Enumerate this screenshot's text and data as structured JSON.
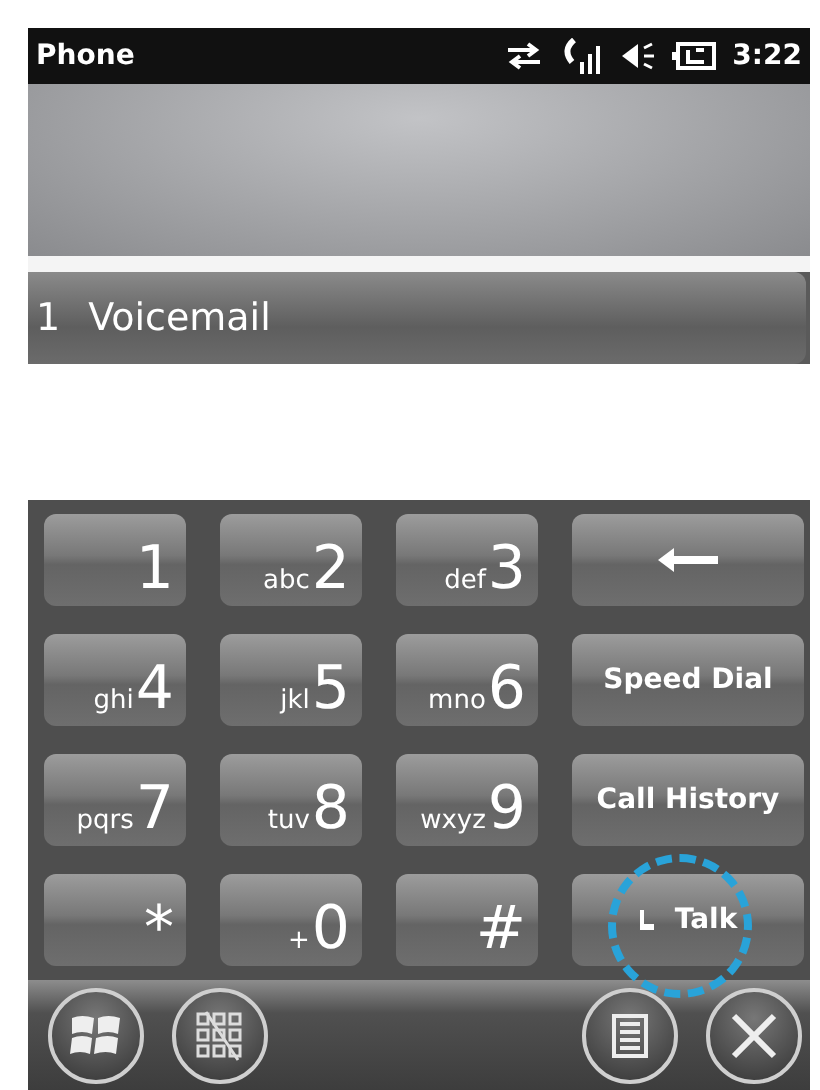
{
  "status_bar": {
    "title": "Phone",
    "time": "3:22"
  },
  "speed_dial_entry": {
    "number": "1",
    "name": "Voicemail"
  },
  "keypad": [
    {
      "kind": "digit",
      "digit": "1"
    },
    {
      "kind": "digit",
      "digit": "2",
      "letters": "abc"
    },
    {
      "kind": "digit",
      "digit": "3",
      "letters": "def"
    },
    {
      "kind": "backspace"
    },
    {
      "kind": "digit",
      "digit": "4",
      "letters": "ghi"
    },
    {
      "kind": "digit",
      "digit": "5",
      "letters": "jkl"
    },
    {
      "kind": "digit",
      "digit": "6",
      "letters": "mno"
    },
    {
      "kind": "action",
      "label": "Speed Dial"
    },
    {
      "kind": "digit",
      "digit": "7",
      "letters": "pqrs"
    },
    {
      "kind": "digit",
      "digit": "8",
      "letters": "tuv"
    },
    {
      "kind": "digit",
      "digit": "9",
      "letters": "wxyz"
    },
    {
      "kind": "action",
      "label": "Call History"
    },
    {
      "kind": "digit",
      "digit": "*"
    },
    {
      "kind": "digit",
      "digit": "0",
      "letters": "+"
    },
    {
      "kind": "digit",
      "digit": "#"
    },
    {
      "kind": "talk",
      "label": "Talk",
      "highlighted": true
    }
  ],
  "bottom_bar": [
    {
      "kind": "start"
    },
    {
      "kind": "keypad"
    },
    {
      "kind": "spacer"
    },
    {
      "kind": "menu"
    },
    {
      "kind": "close"
    }
  ]
}
